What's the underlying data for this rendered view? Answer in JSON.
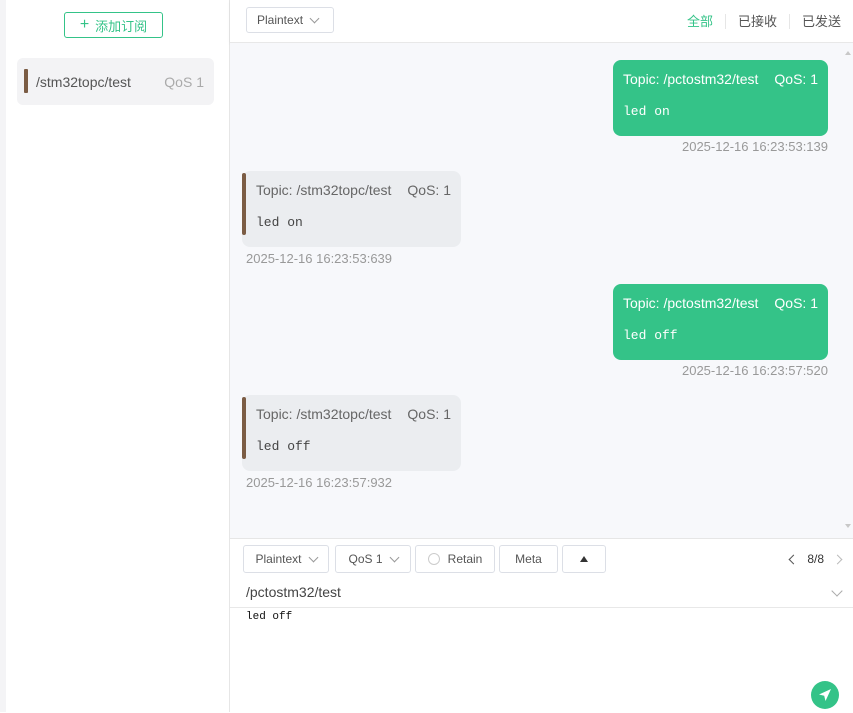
{
  "sidebar": {
    "add_label": "添加订阅",
    "subscriptions": [
      {
        "topic": "/stm32topc/test",
        "qos": "QoS 1",
        "color": "#7b5c44"
      }
    ]
  },
  "header": {
    "format": "Plaintext",
    "tabs": [
      "全部",
      "已接收",
      "已发送"
    ],
    "active_tab": "全部"
  },
  "messages": [
    {
      "dir": "sent",
      "topic": "Topic: /pctostm32/test",
      "qos": "QoS: 1",
      "payload": "led on",
      "time": "2025-12-16 16:23:53:139"
    },
    {
      "dir": "recv",
      "topic": "Topic: /stm32topc/test",
      "qos": "QoS: 1",
      "payload": "led on",
      "time": "2025-12-16 16:23:53:639"
    },
    {
      "dir": "sent",
      "topic": "Topic: /pctostm32/test",
      "qos": "QoS: 1",
      "payload": "led off",
      "time": "2025-12-16 16:23:57:520"
    },
    {
      "dir": "recv",
      "topic": "Topic: /stm32topc/test",
      "qos": "QoS: 1",
      "payload": "led off",
      "time": "2025-12-16 16:23:57:932"
    }
  ],
  "composer": {
    "format": "Plaintext",
    "qos": "QoS 1",
    "retain_label": "Retain",
    "meta_label": "Meta",
    "pager": "8/8",
    "topic": "/pctostm32/test",
    "payload": "led off"
  },
  "colors": {
    "accent": "#34c388",
    "received_bar": "#7b5c44"
  }
}
